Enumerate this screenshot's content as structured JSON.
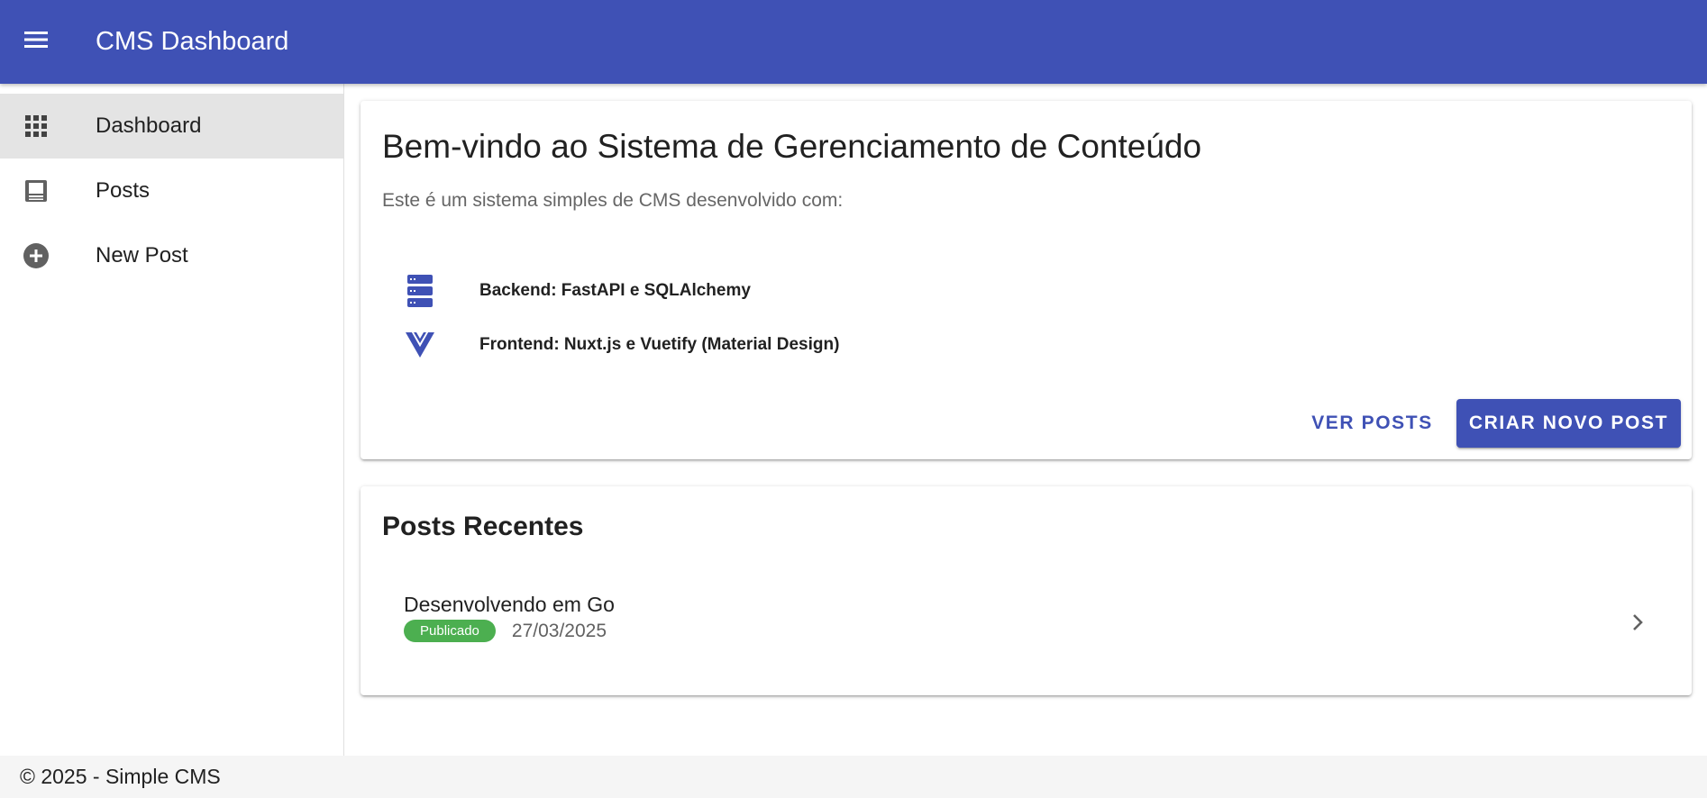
{
  "appbar": {
    "title": "CMS Dashboard",
    "menu_icon": "menu-icon",
    "color": "#3f51b5"
  },
  "sidebar": {
    "items": [
      {
        "label": "Dashboard",
        "icon": "apps-grid-icon",
        "active": true
      },
      {
        "label": "Posts",
        "icon": "post-icon",
        "active": false
      },
      {
        "label": "New Post",
        "icon": "plus-circle-icon",
        "active": false
      }
    ]
  },
  "welcome": {
    "title": "Bem-vindo ao Sistema de Gerenciamento de Conteúdo",
    "subtitle": "Este é um sistema simples de CMS desenvolvido com:",
    "tech": [
      {
        "label": "Backend: FastAPI e SQLAlchemy",
        "icon": "server-icon"
      },
      {
        "label": "Frontend: Nuxt.js e Vuetify (Material Design)",
        "icon": "vuejs-icon"
      }
    ],
    "actions": {
      "view_posts": "VER POSTS",
      "create_post": "CRIAR NOVO POST"
    }
  },
  "recent": {
    "title": "Posts Recentes",
    "posts": [
      {
        "title": "Desenvolvendo em Go",
        "status": "Publicado",
        "date": "27/03/2025",
        "status_color": "#4caf50"
      }
    ]
  },
  "footer": {
    "text": "© 2025 - Simple CMS"
  }
}
